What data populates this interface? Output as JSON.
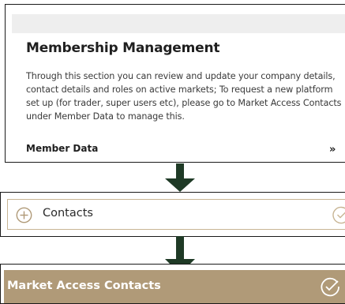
{
  "membership": {
    "title": "Membership Management",
    "description": "Through this section you can review and update your company details, contact details and roles on active markets; To request a new platform set up (for trader, super users etc), please go to Market Access Contacts under Member Data to manage this.",
    "link_label": "Member Data",
    "link_chevron": "»"
  },
  "contacts": {
    "label": "Contacts",
    "expand_icon": "plus-circle-icon",
    "status_icon": "check-circle-icon"
  },
  "market_access": {
    "label": "Market Access Contacts",
    "status_icon": "check-circle-icon"
  },
  "colors": {
    "accent_gold": "#b09a78",
    "accent_border": "#c8b594",
    "arrow": "#1f3a26",
    "text": "#1f1f1f"
  }
}
